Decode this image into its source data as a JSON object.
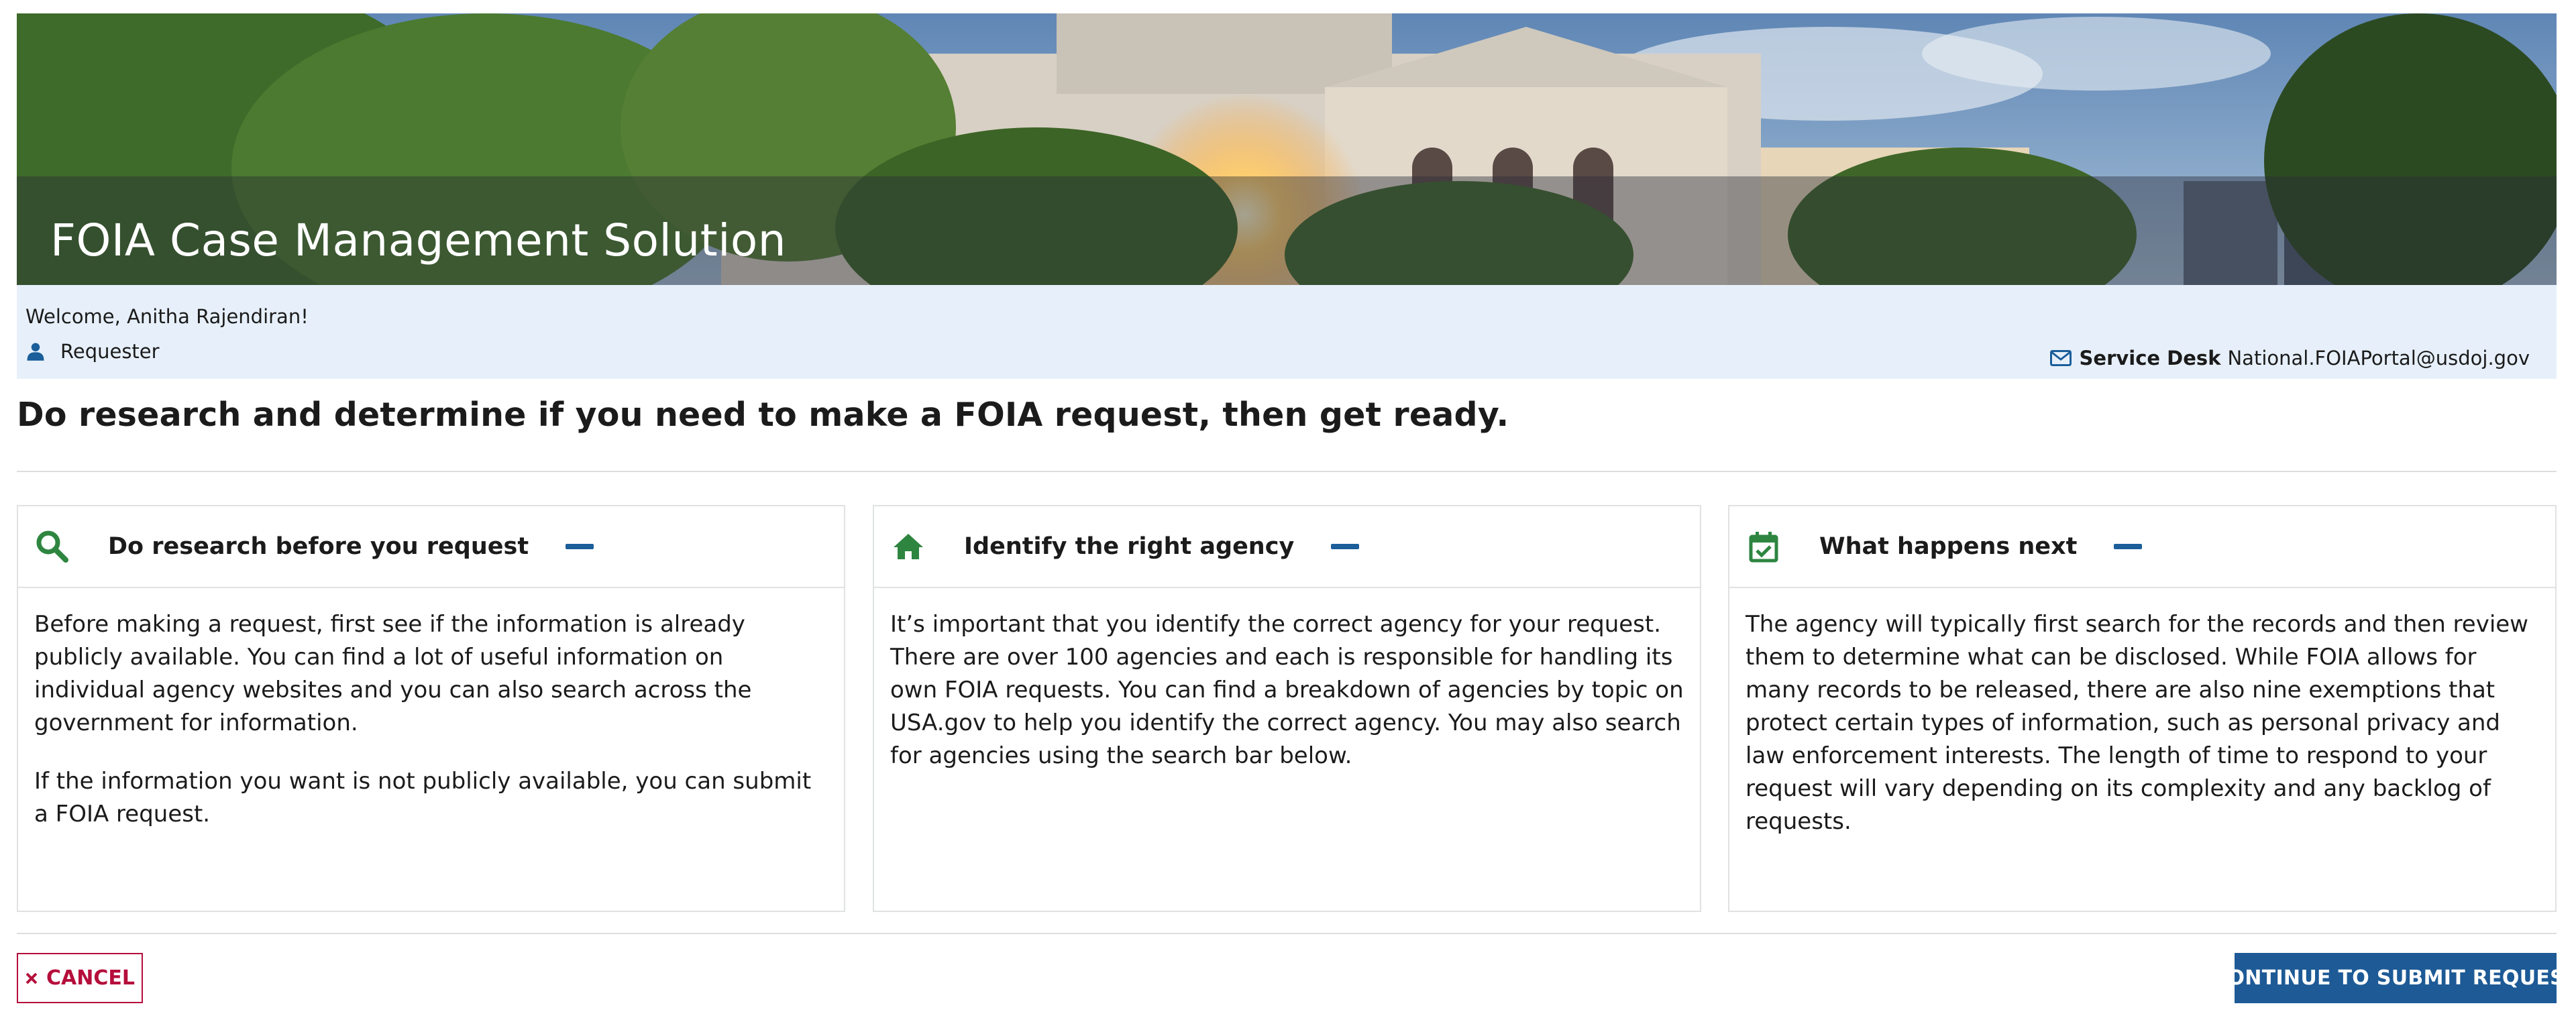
{
  "banner": {
    "title": "FOIA Case Management Solution"
  },
  "user": {
    "welcome": "Welcome, Anitha Rajendiran!",
    "role": "Requester",
    "role_icon": "person-icon"
  },
  "service_desk": {
    "icon": "mail-icon",
    "label": "Service Desk",
    "email": "National.FOIAPortal@usdoj.gov"
  },
  "page": {
    "heading": "Do research and determine if you need to make a FOIA request, then get ready."
  },
  "cards": [
    {
      "icon": "search-icon",
      "title": "Do research before you request",
      "toggle_icon": "minus-icon",
      "paragraphs": [
        "Before making a request, first see if the information is already publicly available. You can find a lot of useful information on individual agency websites and you can also search across the government for information.",
        "If the information you want is not publicly available, you can submit a FOIA request."
      ]
    },
    {
      "icon": "home-icon",
      "title": "Identify the right agency",
      "toggle_icon": "minus-icon",
      "paragraphs": [
        "It’s important that you identify the correct agency for your request. There are over 100 agencies and each is responsible for handling its own FOIA requests. You can find a breakdown of agencies by topic on USA.gov to help you identify the correct agency. You may also search for agencies using the search bar below."
      ]
    },
    {
      "icon": "calendar-check-icon",
      "title": "What happens next",
      "toggle_icon": "minus-icon",
      "paragraphs": [
        "The agency will typically first search for the records and then review them to determine what can be disclosed. While FOIA allows for many records to be released, there are also nine exemptions that protect certain types of information, such as personal privacy and law enforcement interests. The length of time to respond to your request will vary depending on its complexity and any backlog of requests."
      ]
    }
  ],
  "actions": {
    "cancel_label": "CANCEL",
    "cancel_icon": "close-icon",
    "continue_label": "CONTINUE TO SUBMIT REQUEST"
  },
  "colors": {
    "accent_green": "#2e8540",
    "toggle_blue": "#1a5e9a",
    "primary_button": "#1d5a96",
    "cancel_red": "#b50e3b",
    "user_bar_bg": "#e7f0fa"
  }
}
